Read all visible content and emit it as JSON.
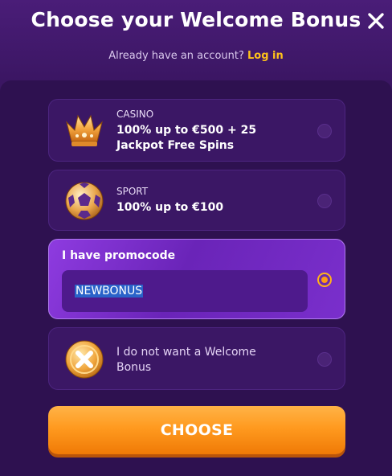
{
  "header": {
    "title": "Choose your Welcome Bonus"
  },
  "account": {
    "prompt": "Already have an account?",
    "login_label": "Log in"
  },
  "options": [
    {
      "category": "CASINO",
      "line1": "100% up to €500 + 25",
      "line2": "Jackpot Free Spins",
      "icon": "crown-icon",
      "selected": false
    },
    {
      "category": "SPORT",
      "line1": "100% up to €100",
      "icon": "soccer-ball-icon",
      "selected": false
    },
    {
      "label": "I have promocode",
      "input_value": "NEWBONUS",
      "selected": true
    },
    {
      "line1": "I do not want a Welcome",
      "line2": "Bonus",
      "icon": "x-coin-icon",
      "selected": false
    }
  ],
  "cta": {
    "label": "CHOOSE"
  },
  "colors": {
    "accent": "#ffc21a",
    "button": "#ff9a1f",
    "background": "#2e1150"
  }
}
